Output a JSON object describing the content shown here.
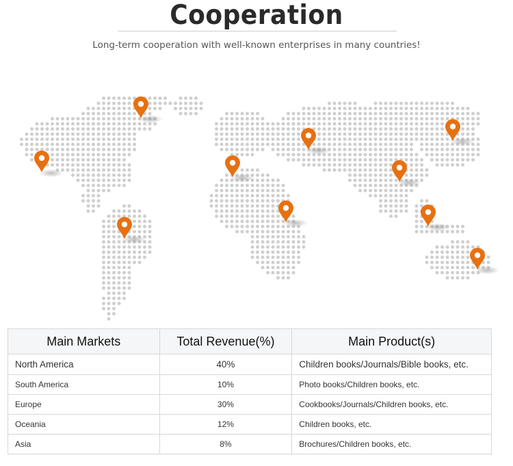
{
  "header": {
    "title": "Cooperation",
    "subtitle": "Long-term cooperation with well-known enterprises in many countries!"
  },
  "map": {
    "pin_color": "#e8700f",
    "dot_color": "#cfcfcf"
  },
  "table": {
    "headers": [
      "Main Markets",
      "Total Revenue(%)",
      "Main Product(s)"
    ],
    "rows": [
      {
        "market": "North America",
        "revenue": "40%",
        "products": "Children books/Journals/Bible books, etc."
      },
      {
        "market": "South America",
        "revenue": "10%",
        "products": "Photo books/Children books, etc."
      },
      {
        "market": "Europe",
        "revenue": "30%",
        "products": "Cookbooks/Journals/Children books, etc."
      },
      {
        "market": "Oceania",
        "revenue": "12%",
        "products": "Children books, etc."
      },
      {
        "market": "Asia",
        "revenue": "8%",
        "products": "Brochures/Children books, etc."
      }
    ]
  }
}
